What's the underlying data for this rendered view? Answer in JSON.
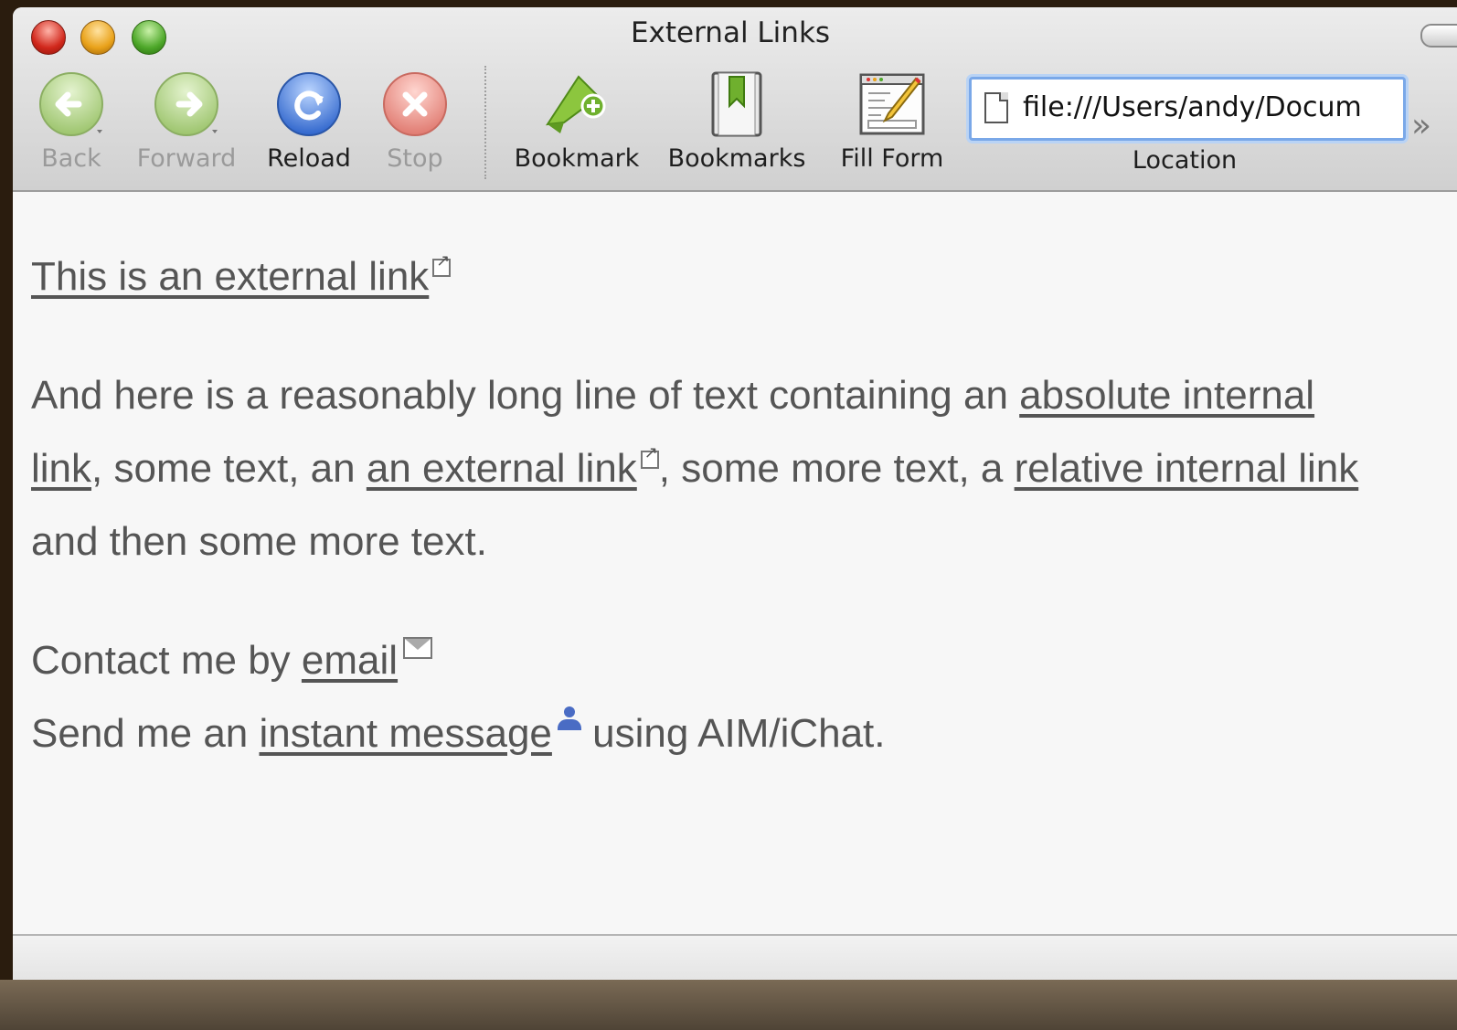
{
  "window": {
    "title": "External Links"
  },
  "toolbar": {
    "back": "Back",
    "forward": "Forward",
    "reload": "Reload",
    "stop": "Stop",
    "bookmark": "Bookmark",
    "bookmarks": "Bookmarks",
    "fill_form": "Fill Form",
    "location_label": "Location",
    "url": "file:///Users/andy/Docum"
  },
  "content": {
    "line1_link": "This is an external link",
    "para2_part1": "And here is a reasonably long line of text containing an ",
    "para2_link1": "absolute internal",
    "para2_link1b": "link",
    "para2_part2": ", some text, an ",
    "para2_link2": "an external link",
    "para2_part3": ", some more text, a ",
    "para2_link3": "relative internal link",
    "para2_part4": "and then some more text.",
    "contact_text": "Contact me by ",
    "contact_link": "email",
    "im_text1": "Send me an ",
    "im_link": "instant message",
    "im_text2": " using AIM/iChat."
  },
  "colors": {
    "accent_focus": "#7aa8e8",
    "reload_blue": "#3b78d8",
    "stop_red": "#e07a70",
    "nav_green": "#a8cf7c"
  },
  "icons": [
    "back-arrow-icon",
    "forward-arrow-icon",
    "reload-icon",
    "stop-icon",
    "bookmark-add-icon",
    "bookmarks-icon",
    "fill-form-icon",
    "document-icon",
    "external-link-icon",
    "mail-icon",
    "person-icon"
  ]
}
